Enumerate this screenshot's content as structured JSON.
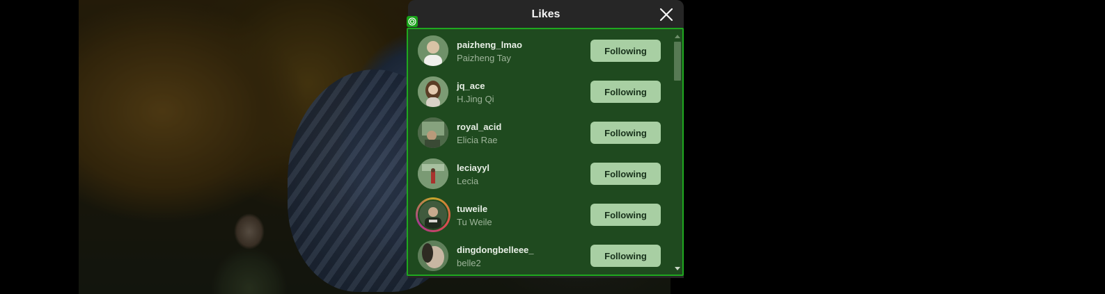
{
  "modal": {
    "title": "Likes",
    "close_icon": "close-icon"
  },
  "users": [
    {
      "username": "paizheng_lmao",
      "full_name": "Paizheng Tay",
      "button": "Following"
    },
    {
      "username": "jq_ace",
      "full_name": "H.Jing Qi",
      "button": "Following"
    },
    {
      "username": "royal_acid",
      "full_name": "Elicia Rae",
      "button": "Following"
    },
    {
      "username": "leciayyl",
      "full_name": "Lecia",
      "button": "Following"
    },
    {
      "username": "tuweile",
      "full_name": "Tu Weile",
      "button": "Following",
      "story_ring": true
    },
    {
      "username": "dingdongbelleee_",
      "full_name": "belle2",
      "button": "Following"
    }
  ],
  "colors": {
    "list_background": "#1f4a1f",
    "focus_outline": "#1fa81f",
    "button": "#a8cfa3"
  }
}
